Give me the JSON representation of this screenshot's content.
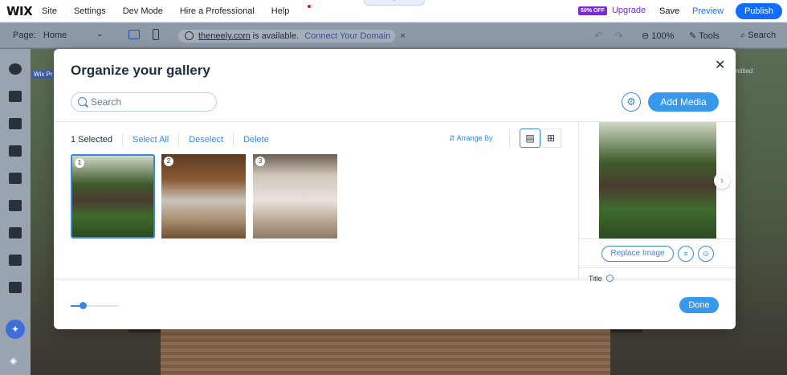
{
  "topbar": {
    "logo": "WIX",
    "menu": [
      "Site",
      "Settings",
      "Dev Mode",
      "Hire a Professional",
      "Help"
    ],
    "upgrade_badge": "50% OFF",
    "upgrade": "Upgrade",
    "save": "Save",
    "preview": "Preview",
    "publish": "Publish"
  },
  "secondbar": {
    "page_label": "Page:",
    "page_value": "Home",
    "domain": "theneely.com",
    "domain_suffix": "is available.",
    "connect": "Connect Your Domain",
    "close": "×",
    "zoom": "100%",
    "tools": "Tools",
    "search": "Search"
  },
  "backdrop": {
    "left_tag": "Wix Pr",
    "right_tag": "ntitled"
  },
  "modal": {
    "title": "Organize your gallery",
    "search_placeholder": "Search",
    "add_media": "Add Media",
    "selected_count": "1 Selected",
    "select_all": "Select All",
    "deselect": "Deselect",
    "delete": "Delete",
    "arrange_by": "Arrange By",
    "items": [
      {
        "num": "1",
        "selected": true
      },
      {
        "num": "2",
        "selected": false
      },
      {
        "num": "3",
        "selected": false
      }
    ],
    "thumb_size": 0.25,
    "done": "Done",
    "panel": {
      "replace_image": "Replace Image",
      "title_label": "Title"
    }
  },
  "colors": {
    "accent": "#3899ec",
    "brand_blue": "#116dff",
    "upgrade_purple": "#7b2bd6"
  }
}
